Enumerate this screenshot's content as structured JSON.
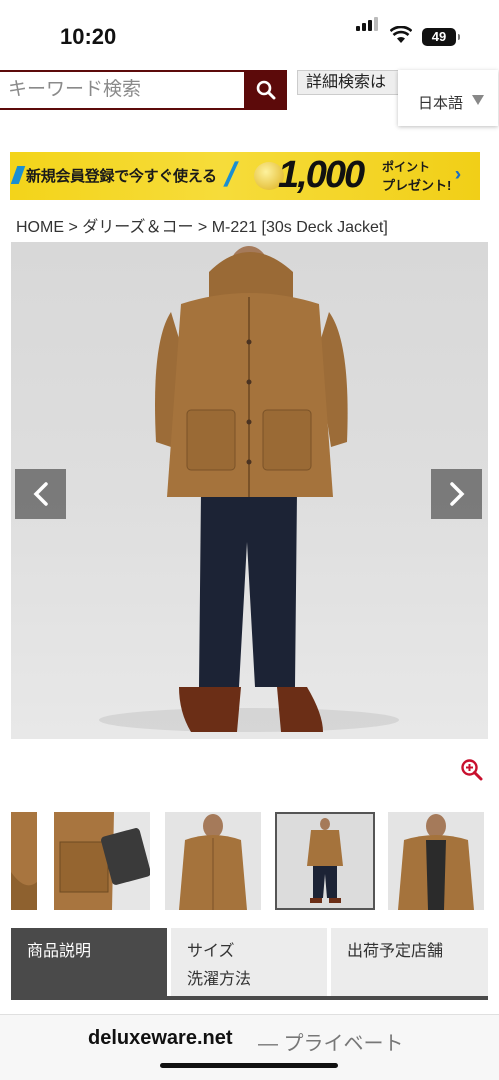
{
  "status_bar": {
    "time": "10:20",
    "battery": "49"
  },
  "search": {
    "placeholder": "キーワード検索",
    "detail_label": "詳細検索は"
  },
  "language": {
    "label": "日本語"
  },
  "banner": {
    "text": "新規会員登録で今すぐ使える",
    "amount": "1,000",
    "points_line1": "ポイント",
    "points_line2": "プレゼント!"
  },
  "breadcrumb": {
    "items": [
      "HOME",
      "ダリーズ＆コー",
      "M-221 [30s Deck Jacket]"
    ],
    "separator": ">"
  },
  "tabs": [
    {
      "label": "商品説明",
      "active": true
    },
    {
      "label": "サイズ\n洗濯方法",
      "active": false
    },
    {
      "label": "出荷予定店舗",
      "active": false
    }
  ],
  "browser": {
    "domain": "deluxeware.net",
    "suffix": "— プライベート"
  },
  "icons": {
    "search": "search-icon",
    "prev": "chevron-left-icon",
    "next": "chevron-right-icon",
    "zoom": "zoom-in-icon",
    "language": "caret-down-icon"
  },
  "colors": {
    "brand": "#5c0a0a",
    "banner": "#f3d41a",
    "tab_active": "#4a4a4a",
    "zoom": "#c8102e"
  }
}
